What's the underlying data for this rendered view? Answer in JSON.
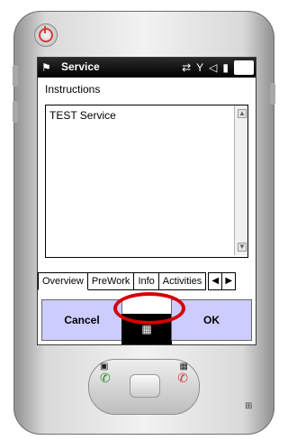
{
  "app": {
    "title": "Service",
    "status_icons": [
      "connectivity-icon",
      "signal-off-icon",
      "mute-icon",
      "battery-icon"
    ],
    "ok_label": "OK"
  },
  "form": {
    "instructions_label": "Instructions",
    "textarea_value": "TEST Service"
  },
  "tabs": {
    "items": [
      {
        "label": "Overview",
        "active": true
      },
      {
        "label": "PreWork",
        "active": false
      },
      {
        "label": "Info",
        "active": false
      },
      {
        "label": "Activities",
        "active": false
      }
    ],
    "nav_left": "◀",
    "nav_right": "▶"
  },
  "menubar": {
    "left_label": "Cancel",
    "right_label": "OK",
    "keyboard_icon": "keyboard-icon"
  },
  "hardware": {
    "power_icon": "power-icon",
    "start_icon": "windows-flag-icon",
    "call_icon": "phone-call-icon",
    "end_call_icon": "phone-end-icon",
    "left_softkey_icon": "left-softkey-icon",
    "right_softkey_icon": "right-softkey-icon",
    "device_logo_icon": "windows-logo-icon"
  },
  "colors": {
    "menu_button": "#ccccff",
    "annotation": "#d60000",
    "title_bar": "#000000"
  }
}
